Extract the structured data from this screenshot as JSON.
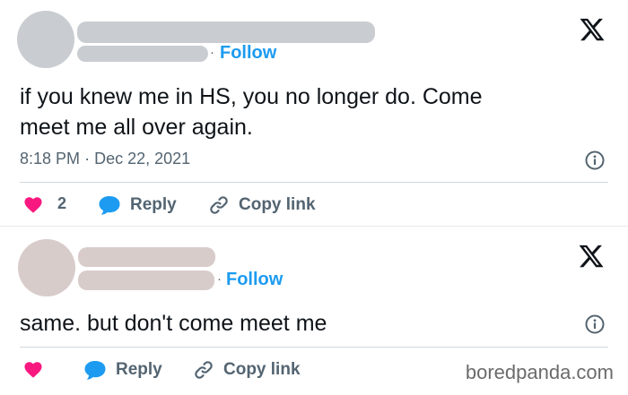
{
  "tweets": [
    {
      "follow_dot": "·",
      "follow_label": "Follow",
      "text_lines": [
        "if you knew me in HS, you no longer  do. Come",
        "meet me all over again."
      ],
      "time": "8:18 PM",
      "time_sep": "·",
      "date": "Dec 22, 2021",
      "like_count": "2",
      "reply_label": "Reply",
      "copy_label": "Copy link",
      "avatar_color": "#c9cdd2",
      "bar_color": "#c9cdd2"
    },
    {
      "follow_dot": "·",
      "follow_label": "Follow",
      "text_lines": [
        "same. but don't come meet me"
      ],
      "reply_label": "Reply",
      "copy_label": "Copy link",
      "avatar_color": "#d8cccb",
      "bar_color": "#d8cccb"
    }
  ],
  "icons": {
    "logo": "x-logo-icon",
    "info": "info-icon",
    "like": "heart-icon",
    "reply": "speech-bubble-icon",
    "copy": "link-icon"
  },
  "colors": {
    "like": "#f91880",
    "reply": "#1d9bf0",
    "follow": "#1d9bf0",
    "muted": "#536471"
  },
  "watermark": "boredpanda.com"
}
